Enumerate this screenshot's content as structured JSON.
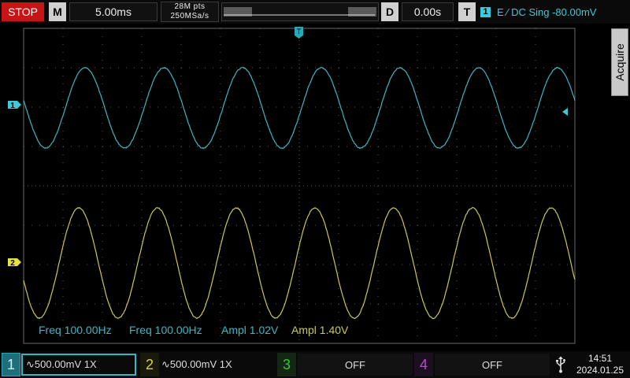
{
  "topbar": {
    "run_state": "STOP",
    "horizontal_key": "M",
    "timebase": "5.00ms",
    "memory_depth": "28M pts",
    "sample_rate": "250MSa/s",
    "delay_key": "D",
    "delay": "0.00s",
    "trigger_key": "T",
    "trigger_source": "1",
    "trigger_info": "E ∕ DC Sing -80.00mV"
  },
  "side_menu": {
    "acquire_label": "Acquire"
  },
  "markers": {
    "trigger_position": "T",
    "ch1_marker": "1",
    "ch2_marker": "2"
  },
  "measurements": [
    {
      "label": "Freq 100.00Hz",
      "channel": 1
    },
    {
      "label": "Freq 100.00Hz",
      "channel": 1
    },
    {
      "label": "Ampl 1.02V",
      "channel": 1
    },
    {
      "label": "Ampl 1.40V",
      "channel": 2
    }
  ],
  "channels": [
    {
      "number": "1",
      "setting": "∿500.00mV 1X",
      "color": "#3fb5c2",
      "active": true
    },
    {
      "number": "2",
      "setting": "∿500.00mV 1X",
      "color": "#c8c85a",
      "active": false
    },
    {
      "number": "3",
      "setting": "OFF",
      "color": "#35c835",
      "active": false
    },
    {
      "number": "4",
      "setting": "OFF",
      "color": "#b050c8",
      "active": false
    }
  ],
  "status": {
    "time": "14:51",
    "date": "2024.01.25"
  },
  "colors": {
    "ch1": "#3fb5c2",
    "ch2": "#c8c85a",
    "stop": "#c81414"
  }
}
